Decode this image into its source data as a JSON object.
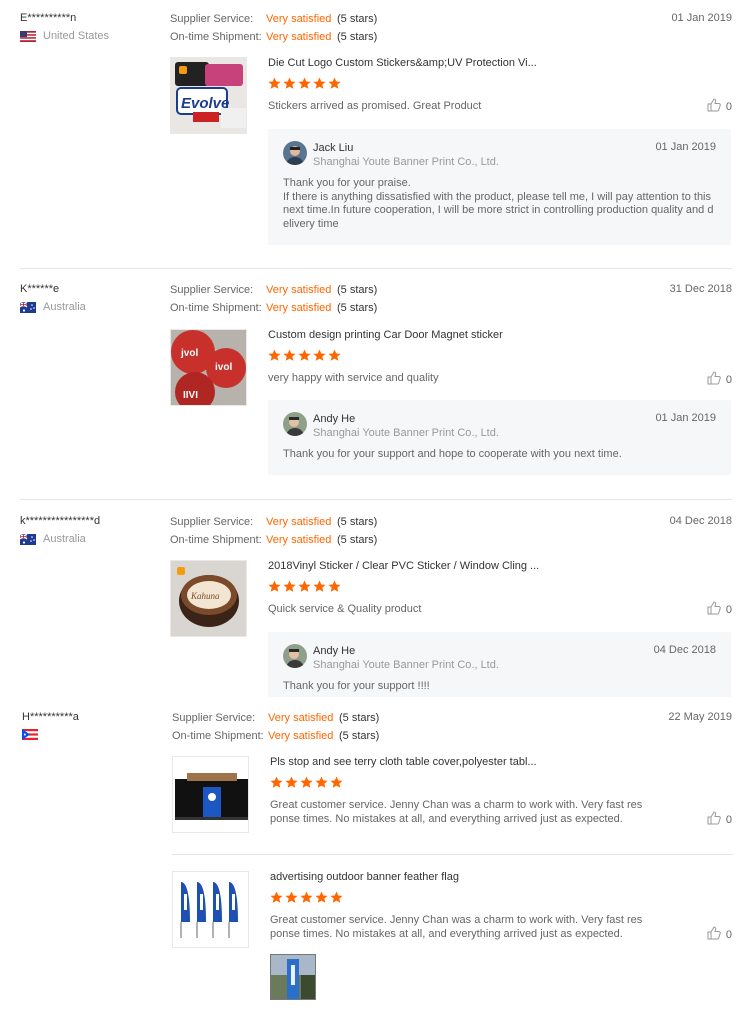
{
  "labels": {
    "supplier_service": "Supplier Service:",
    "ontime_shipment": "On-time Shipment:",
    "very_satisfied": "Very satisfied",
    "five_stars": "(5 stars)"
  },
  "colors": {
    "accent": "#ff6600",
    "muted": "#999999",
    "reply_bg": "#f6f7f9"
  },
  "reviews": [
    {
      "user": "E**********n",
      "country": "United States",
      "date": "01 Jan 2019",
      "product_title": "Die Cut Logo Custom Stickers&amp;UV Protection Vi...",
      "rating": 5,
      "comment": "Stickers arrived as promised. Great Product",
      "likes": "0",
      "reply": {
        "name": "Jack Liu",
        "company": "Shanghai Youte Banner Print Co., Ltd.",
        "date": "01 Jan 2019",
        "text": "Thank you for your praise.\nIf there is anything dissatisfied with the product, please tell me, I will pay attention to this next time.In future cooperation, I will be more strict in controlling production quality and delivery time"
      }
    },
    {
      "user": "K******e",
      "country": "Australia",
      "date": "31 Dec 2018",
      "product_title": "Custom design printing Car Door Magnet sticker",
      "rating": 5,
      "comment": "very happy with service and quality",
      "likes": "0",
      "reply": {
        "name": "Andy He",
        "company": "Shanghai Youte Banner Print Co., Ltd.",
        "date": "01 Jan 2019",
        "text": "Thank you for your support and hope to cooperate with you next time."
      }
    },
    {
      "user": "k****************d",
      "country": "Australia",
      "date": "04 Dec 2018",
      "product_title": "2018Vinyl Sticker / Clear PVC Sticker / Window Cling ...",
      "rating": 5,
      "comment": "Quick service & Quality product",
      "likes": "0",
      "reply": {
        "name": "Andy He",
        "company": "Shanghai Youte Banner Print Co., Ltd.",
        "date": "04 Dec 2018",
        "text": "Thank you for your support !!!!"
      }
    },
    {
      "user": "H**********a",
      "country": "",
      "date": "22 May 2019",
      "products": [
        {
          "product_title": "Pls stop and see terry cloth table cover,polyester tabl...",
          "rating": 5,
          "comment": "Great customer service. Jenny Chan was a charm to work with. Very fast response times. No mistakes at all, and everything arrived just as expected.",
          "likes": "0"
        },
        {
          "product_title": "advertising outdoor banner feather flag",
          "rating": 5,
          "comment": "Great customer service. Jenny Chan was a charm to work with. Very fast response times. No mistakes at all, and everything arrived just as expected.",
          "likes": "0"
        }
      ]
    }
  ]
}
